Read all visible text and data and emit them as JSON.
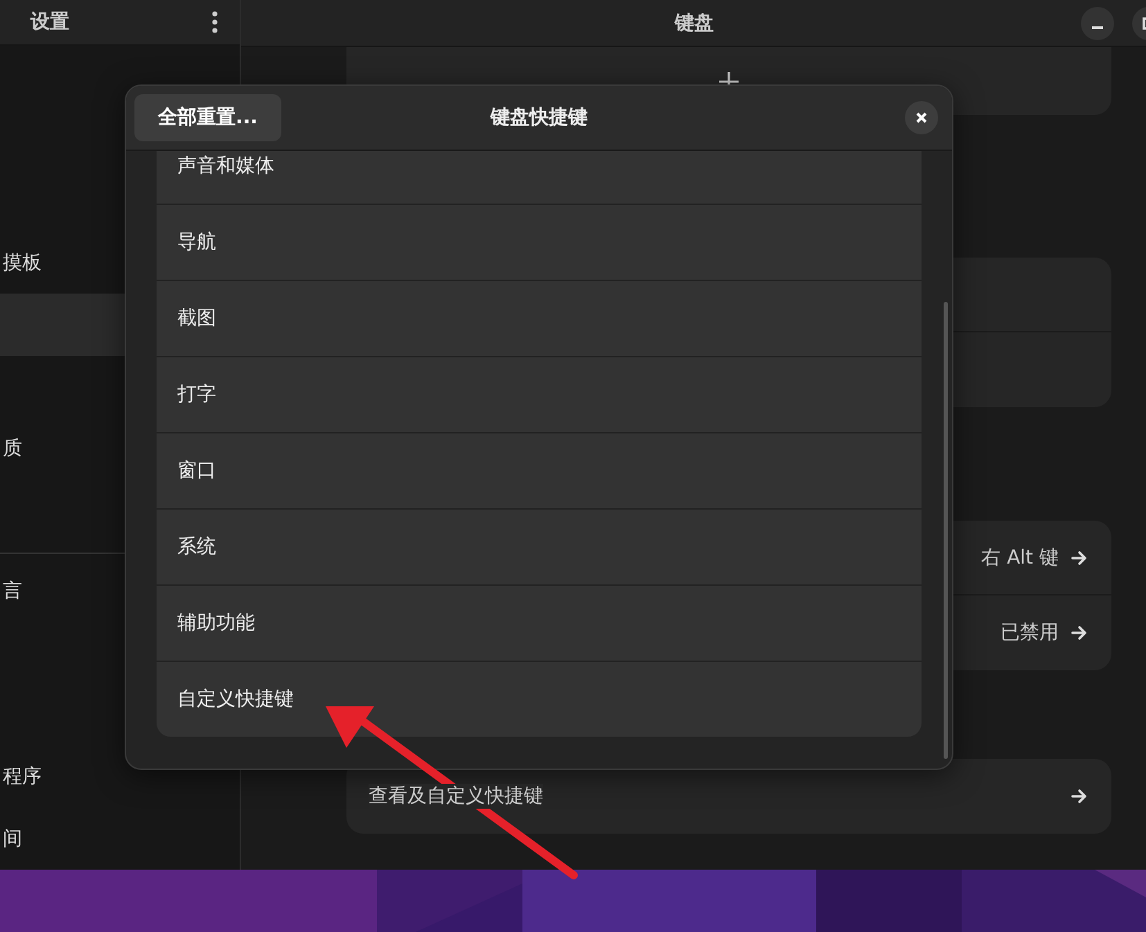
{
  "sidebar": {
    "title": "设置",
    "groups": [
      [
        {
          "selected": false
        },
        {
          "selected": false
        },
        {
          "selected": false
        },
        {
          "label": "摸板",
          "selected": false
        },
        {
          "selected": true
        },
        {
          "selected": false
        },
        {
          "label": "质",
          "selected": false
        },
        {
          "selected": false
        }
      ],
      [
        {
          "label": "言",
          "selected": false
        },
        {
          "selected": false
        },
        {
          "selected": false
        },
        {
          "label": "程序",
          "selected": false
        },
        {
          "label": "间",
          "selected": false
        }
      ]
    ]
  },
  "main": {
    "title": "键盘",
    "cards": [
      {
        "rows": [
          {
            "kind": "add"
          }
        ]
      },
      {
        "rows": [
          {
            "kind": "blank"
          },
          {
            "kind": "blank"
          }
        ]
      },
      {
        "rows": [
          {
            "kind": "value",
            "value": "右 Alt 键"
          },
          {
            "kind": "value",
            "value": "已禁用"
          }
        ]
      },
      {
        "rows": [
          {
            "kind": "link",
            "label": "查看及自定义快捷键"
          }
        ]
      }
    ]
  },
  "dialog": {
    "title": "键盘快捷键",
    "reset_button": "全部重置...",
    "categories": [
      {
        "label": "声音和媒体"
      },
      {
        "label": "导航"
      },
      {
        "label": "截图"
      },
      {
        "label": "打字"
      },
      {
        "label": "窗口"
      },
      {
        "label": "系统"
      },
      {
        "label": "辅助功能"
      },
      {
        "label": "自定义快捷键"
      }
    ]
  }
}
